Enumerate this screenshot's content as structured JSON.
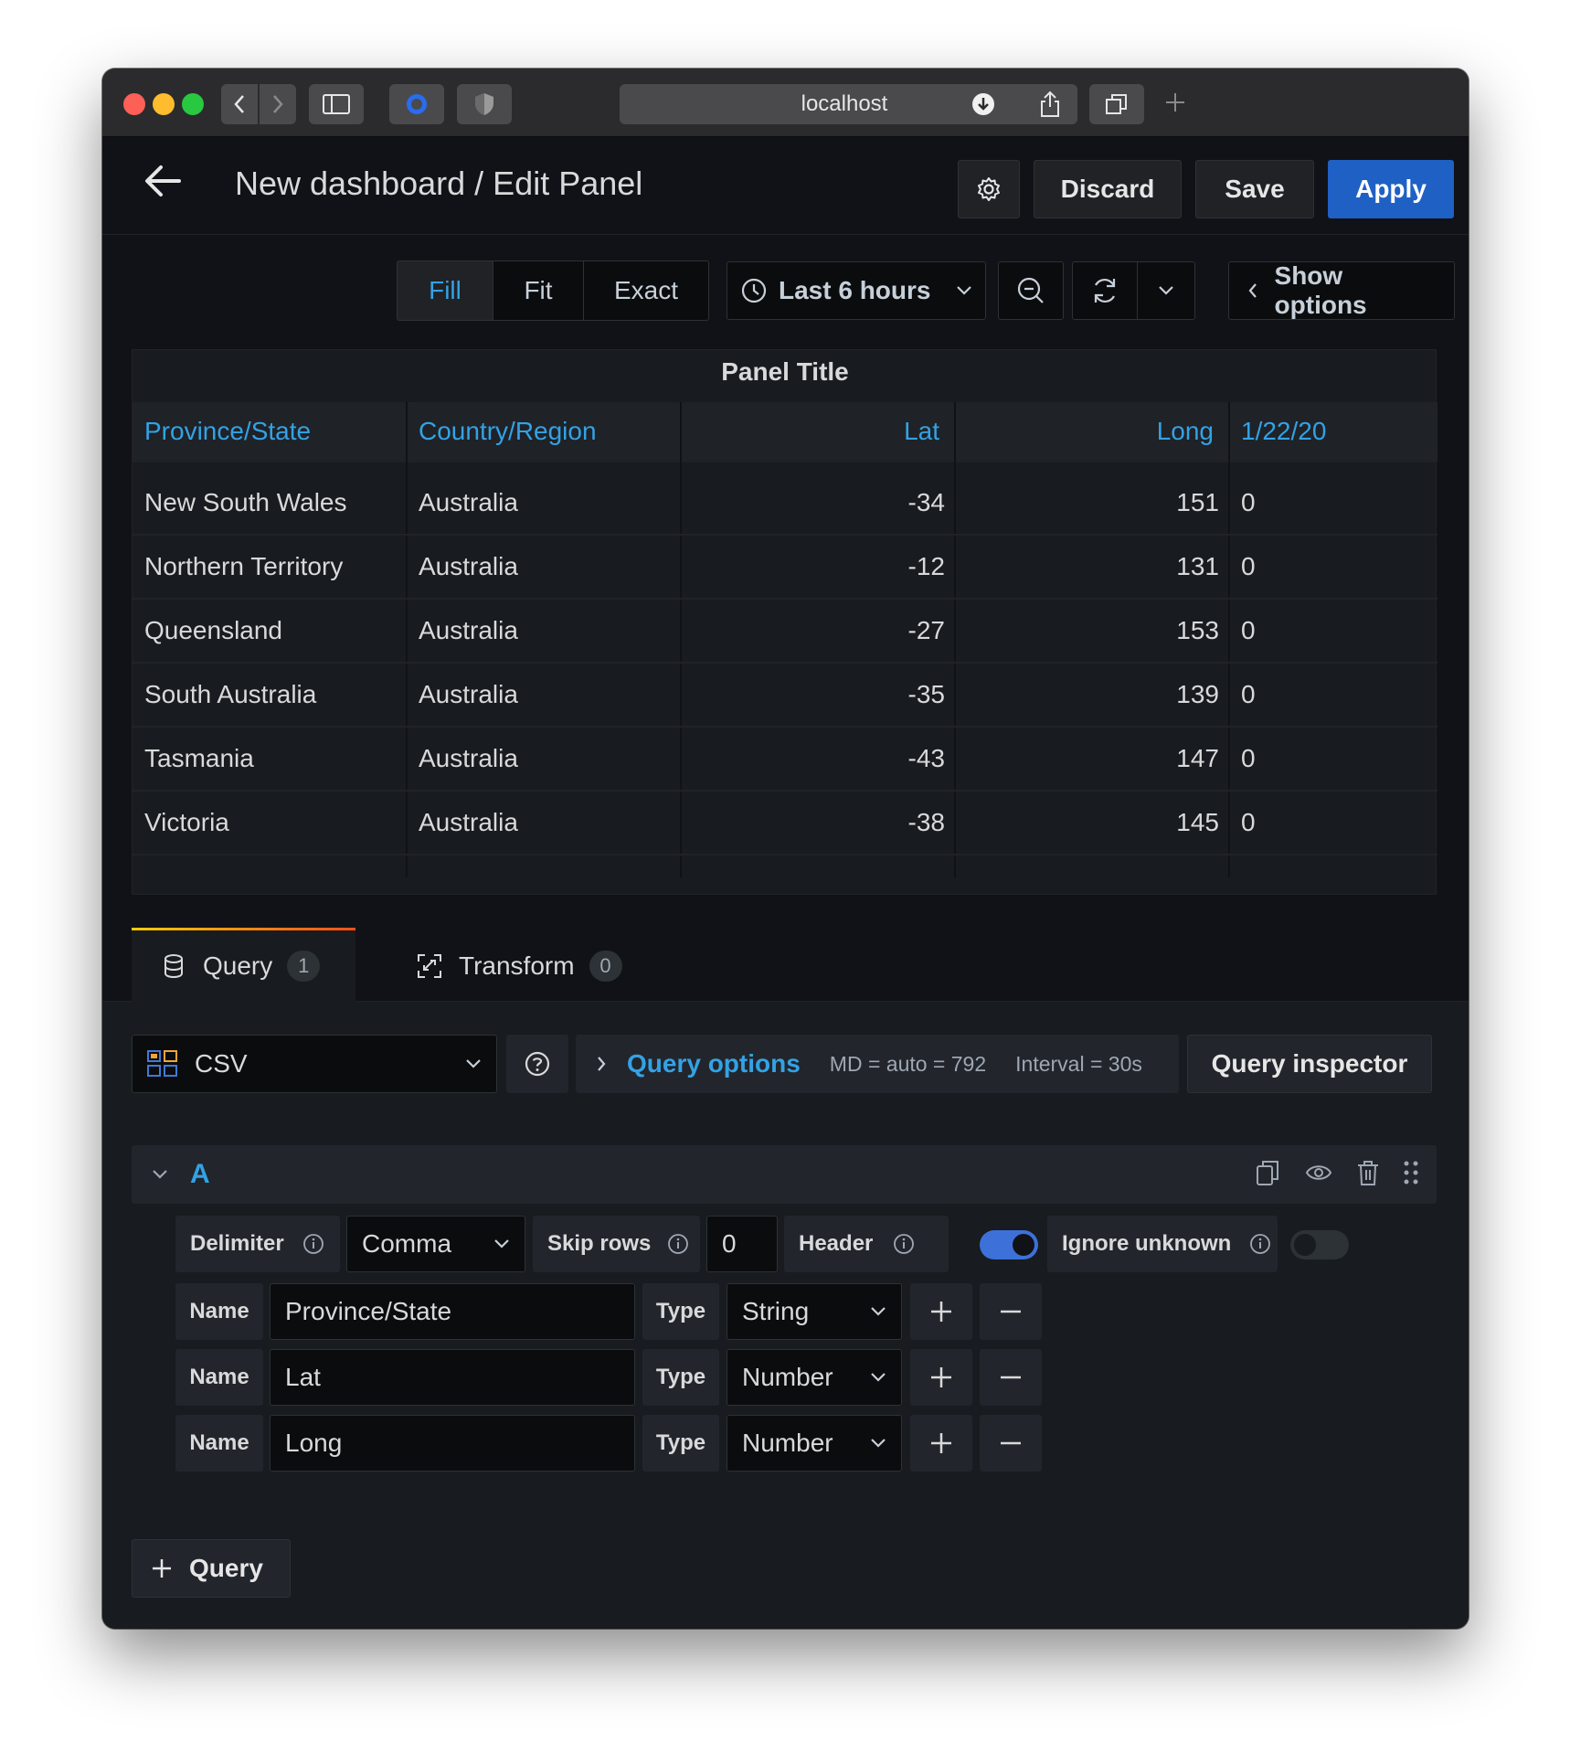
{
  "browser": {
    "url": "localhost"
  },
  "header": {
    "title": "New dashboard / Edit Panel",
    "discard_label": "Discard",
    "save_label": "Save",
    "apply_label": "Apply"
  },
  "toolbar": {
    "fill": "Fill",
    "fit": "Fit",
    "exact": "Exact",
    "time_range": "Last 6 hours",
    "show_options": "Show options"
  },
  "panel": {
    "title": "Panel Title",
    "columns": [
      "Province/State",
      "Country/Region",
      "Lat",
      "Long",
      "1/22/20"
    ],
    "rows": [
      [
        "New South Wales",
        "Australia",
        "-34",
        "151",
        "0"
      ],
      [
        "Northern Territory",
        "Australia",
        "-12",
        "131",
        "0"
      ],
      [
        "Queensland",
        "Australia",
        "-27",
        "153",
        "0"
      ],
      [
        "South Australia",
        "Australia",
        "-35",
        "139",
        "0"
      ],
      [
        "Tasmania",
        "Australia",
        "-43",
        "147",
        "0"
      ],
      [
        "Victoria",
        "Australia",
        "-38",
        "145",
        "0"
      ]
    ]
  },
  "tabs": {
    "query_label": "Query",
    "query_count": "1",
    "transform_label": "Transform",
    "transform_count": "0"
  },
  "datasource": {
    "name": "CSV",
    "query_options_label": "Query options",
    "md": "MD = auto = 792",
    "interval": "Interval = 30s",
    "inspector_label": "Query inspector"
  },
  "query_a": {
    "ref": "A",
    "delimiter_label": "Delimiter",
    "delimiter_value": "Comma",
    "skip_rows_label": "Skip rows",
    "skip_rows_value": "0",
    "header_label": "Header",
    "header_on": true,
    "ignore_unknown_label": "Ignore unknown",
    "ignore_unknown_on": false,
    "fields": [
      {
        "name_label": "Name",
        "name": "Province/State",
        "type_label": "Type",
        "type": "String"
      },
      {
        "name_label": "Name",
        "name": "Lat",
        "type_label": "Type",
        "type": "Number"
      },
      {
        "name_label": "Name",
        "name": "Long",
        "type_label": "Type",
        "type": "Number"
      }
    ]
  },
  "add_query_label": "Query",
  "colors": {
    "accent_blue": "#33a2e5",
    "primary_button": "#1f60c4",
    "background": "#111217",
    "panel_bg": "#181b1f"
  }
}
